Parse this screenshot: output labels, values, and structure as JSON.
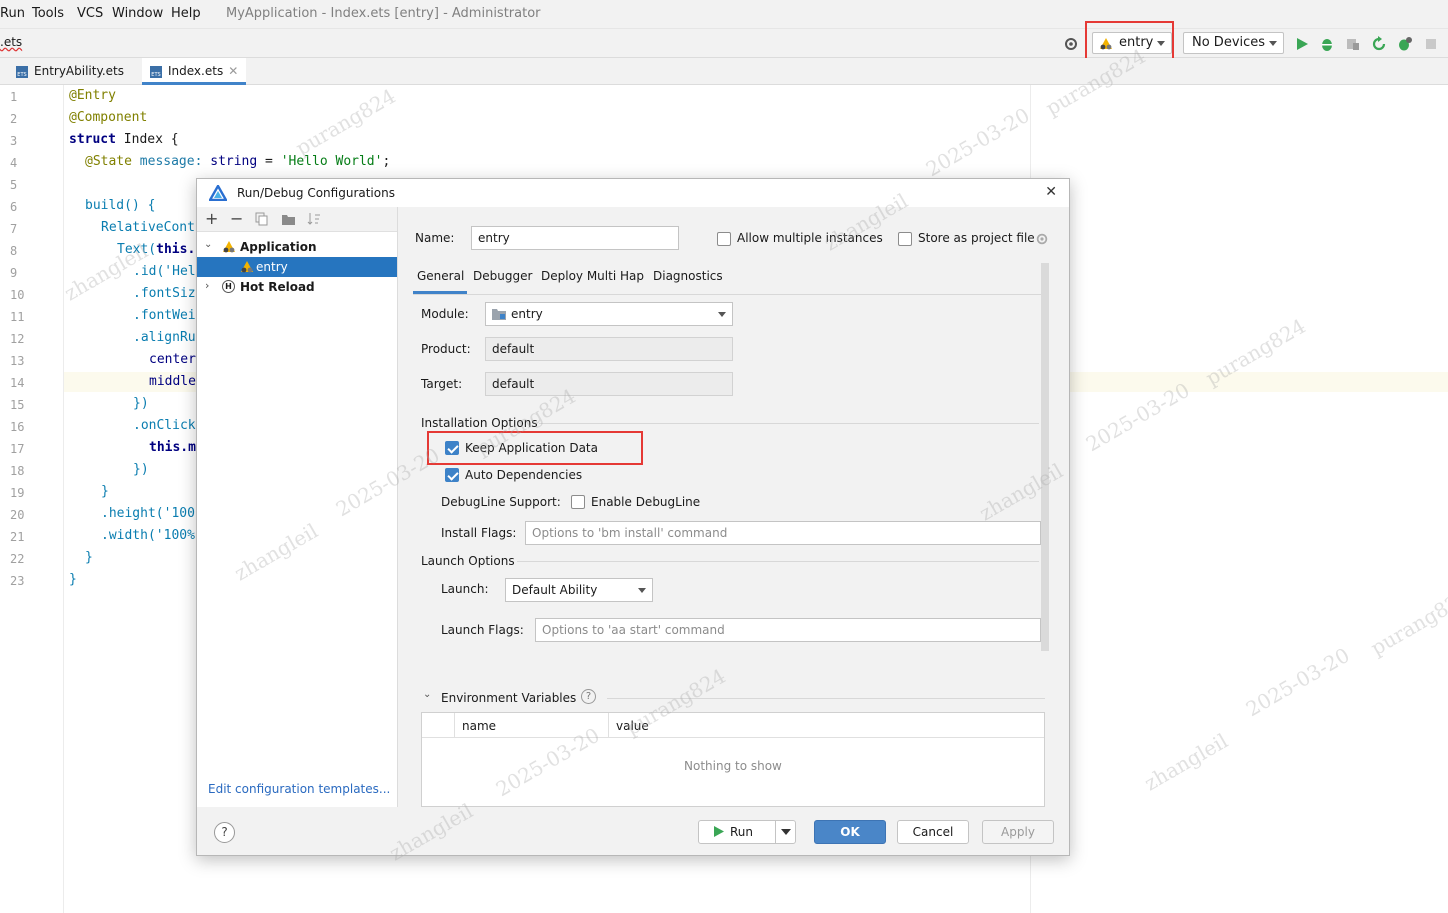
{
  "menubar": {
    "items": [
      "Run",
      "Tools",
      "VCS",
      "Window",
      "Help"
    ],
    "window_title": "MyApplication - Index.ets [entry] - Administrator"
  },
  "toolbar": {
    "breadcrumb": ".ets",
    "run_config": "entry",
    "device": "No Devices"
  },
  "tabs": [
    {
      "label": "EntryAbility.ets"
    },
    {
      "label": "Index.ets"
    }
  ],
  "editor": {
    "line_numbers": [
      "1",
      "2",
      "3",
      "4",
      "5",
      "6",
      "7",
      "8",
      "9",
      "10",
      "11",
      "12",
      "13",
      "14",
      "15",
      "16",
      "17",
      "18",
      "19",
      "20",
      "21",
      "22",
      "23"
    ],
    "lines": {
      "l1": "@Entry",
      "l2": "@Component",
      "l3_kw": "struct",
      "l3_name": " Index {",
      "l4_ann": "@State",
      "l4_rest": " message: ",
      "l4_type": "string",
      "l4_eq": " = ",
      "l4_str": "'Hello World'",
      "l4_end": ";",
      "l6": "build() {",
      "l7": "RelativeCont",
      "l8_a": "Text(",
      "l8_b": "this.",
      "l9": ".id('Hel",
      "l10": ".fontSiz",
      "l11": ".fontWei",
      "l12": ".alignRu",
      "l13": "center",
      "l14": "middle",
      "l15": "})",
      "l16": ".onClick",
      "l17": "this.m",
      "l18": "})",
      "l19": "}",
      "l20": ".height('100",
      "l21": ".width('100%",
      "l22": "}",
      "l23": "}"
    }
  },
  "dialog": {
    "title": "Run/Debug Configurations",
    "tree": {
      "application": "Application",
      "entry": "entry",
      "hot_reload": "Hot Reload"
    },
    "edit_templates": "Edit configuration templates...",
    "name_label": "Name:",
    "name_value": "entry",
    "allow_multiple": "Allow multiple instances",
    "store_project": "Store as project file",
    "subtabs": [
      "General",
      "Debugger",
      "Deploy Multi Hap",
      "Diagnostics"
    ],
    "module_label": "Module:",
    "module_value": "entry",
    "product_label": "Product:",
    "product_value": "default",
    "target_label": "Target:",
    "target_value": "default",
    "installation_options": "Installation Options",
    "keep_app_data": "Keep Application Data",
    "keep_app_data_checked": true,
    "auto_dependencies": "Auto Dependencies",
    "auto_dependencies_checked": true,
    "debugline_label": "DebugLine Support:",
    "enable_debugline": "Enable DebugLine",
    "enable_debugline_checked": false,
    "install_flags_label": "Install Flags:",
    "install_flags_placeholder": "Options to 'bm install' command",
    "launch_options": "Launch Options",
    "launch_label": "Launch:",
    "launch_value": "Default Ability",
    "launch_flags_label": "Launch Flags:",
    "launch_flags_placeholder": "Options to 'aa start' command",
    "env_vars": "Environment Variables",
    "env_columns": [
      "name",
      "value"
    ],
    "env_empty": "Nothing to show",
    "buttons": {
      "run": "Run",
      "ok": "OK",
      "cancel": "Cancel",
      "apply": "Apply"
    }
  },
  "watermark": {
    "user1": "zhangleil",
    "user2": "purang824",
    "date": "2025-03-20"
  },
  "colors": {
    "highlight": "#e53935",
    "selection": "#2675bf",
    "primary_button": "#4a86c8",
    "run_green": "#3aa655"
  }
}
